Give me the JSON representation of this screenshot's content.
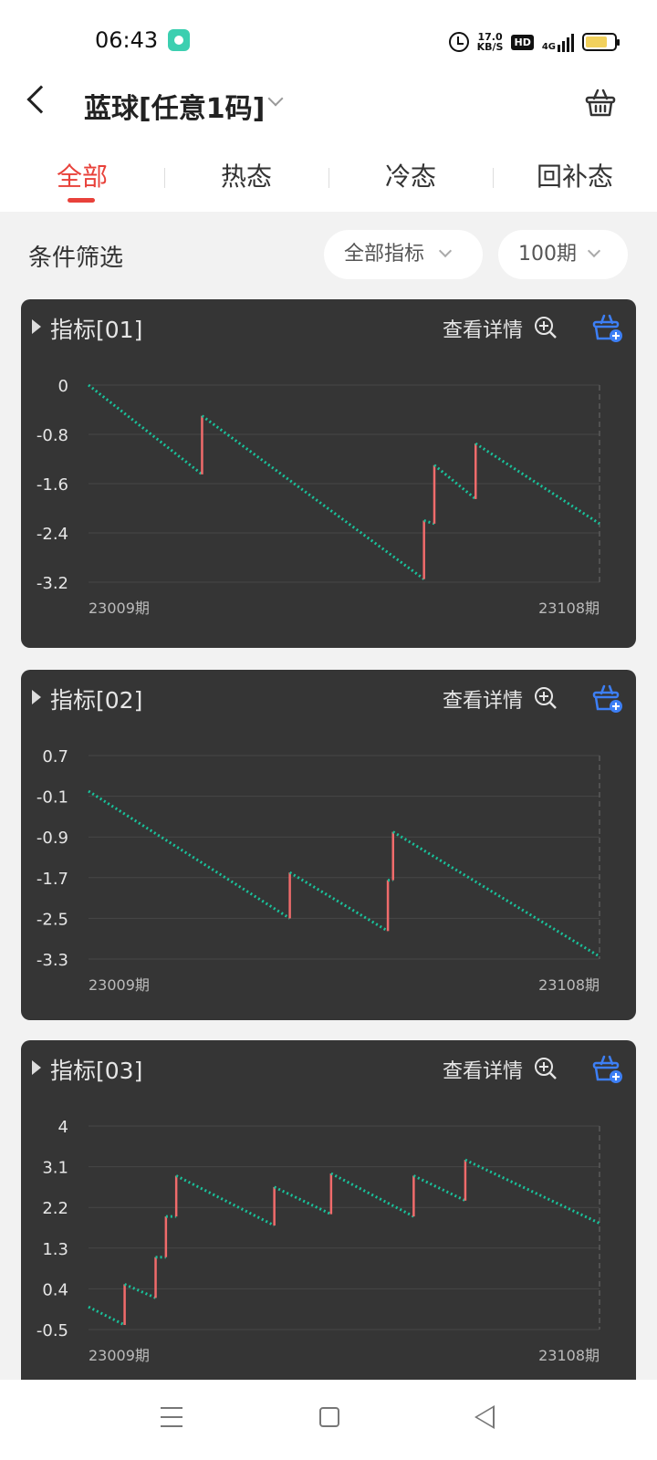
{
  "status_bar": {
    "time": "06:43",
    "net_speed_value": "17.0",
    "net_speed_unit": "KB/S",
    "hd_label": "HD",
    "network_type": "4G",
    "battery_level": 0.75,
    "battery_color": "#f2d15c"
  },
  "header": {
    "title": "蓝球[任意1码]",
    "back_icon": "chevron-left-icon",
    "cart_icon": "basket-icon"
  },
  "tabs": [
    {
      "label": "全部",
      "active": true
    },
    {
      "label": "热态",
      "active": false
    },
    {
      "label": "冷态",
      "active": false
    },
    {
      "label": "回补态",
      "active": false
    }
  ],
  "filter": {
    "label": "条件筛选",
    "indicator_select": "全部指标",
    "period_select": "100期"
  },
  "colors": {
    "accent": "#e8413a",
    "card_bg": "#353535",
    "line_green": "#19c29b",
    "jump_red": "#f06b6b",
    "basket_blue": "#3d7ff5"
  },
  "cards": [
    {
      "title": "指标[01]",
      "detail_label": "查看详情",
      "chart_data": {
        "type": "line",
        "x_start": "23009期",
        "x_end": "23108期",
        "yticks": [
          "0",
          "-0.8",
          "-1.6",
          "-2.4",
          "-3.2"
        ],
        "ylim": [
          -3.2,
          0
        ],
        "xlim": [
          0,
          99
        ],
        "vline_x": 99,
        "segments": [
          {
            "x0": 0,
            "y0": 0,
            "x1": 22,
            "y1": -1.45
          },
          {
            "x0": 22,
            "y0": -0.5,
            "x1": 65,
            "y1": -3.15
          },
          {
            "x0": 65,
            "y0": -2.2,
            "x1": 67,
            "y1": -2.25
          },
          {
            "x0": 67,
            "y0": -1.3,
            "x1": 75,
            "y1": -1.85
          },
          {
            "x0": 75,
            "y0": -0.95,
            "x1": 99,
            "y1": -2.25
          }
        ]
      }
    },
    {
      "title": "指标[02]",
      "detail_label": "查看详情",
      "chart_data": {
        "type": "line",
        "x_start": "23009期",
        "x_end": "23108期",
        "yticks": [
          "0.7",
          "-0.1",
          "-0.9",
          "-1.7",
          "-2.5",
          "-3.3"
        ],
        "ylim": [
          -3.3,
          0.7
        ],
        "xlim": [
          0,
          99
        ],
        "vline_x": 99,
        "segments": [
          {
            "x0": 0,
            "y0": 0.0,
            "x1": 39,
            "y1": -2.5
          },
          {
            "x0": 39,
            "y0": -1.6,
            "x1": 58,
            "y1": -2.75
          },
          {
            "x0": 58,
            "y0": -1.75,
            "x1": 59,
            "y1": -1.75
          },
          {
            "x0": 59,
            "y0": -0.8,
            "x1": 99,
            "y1": -3.25
          }
        ]
      }
    },
    {
      "title": "指标[03]",
      "detail_label": "查看详情",
      "chart_data": {
        "type": "line",
        "x_start": "23009期",
        "x_end": "23108期",
        "yticks": [
          "4",
          "3.1",
          "2.2",
          "1.3",
          "0.4",
          "-0.5"
        ],
        "ylim": [
          -0.5,
          4
        ],
        "xlim": [
          0,
          99
        ],
        "vline_x": 99,
        "segments": [
          {
            "x0": 0,
            "y0": 0.0,
            "x1": 7,
            "y1": -0.4
          },
          {
            "x0": 7,
            "y0": 0.5,
            "x1": 13,
            "y1": 0.2
          },
          {
            "x0": 13,
            "y0": 1.1,
            "x1": 15,
            "y1": 1.1
          },
          {
            "x0": 15,
            "y0": 2.0,
            "x1": 17,
            "y1": 2.0
          },
          {
            "x0": 17,
            "y0": 2.9,
            "x1": 36,
            "y1": 1.8
          },
          {
            "x0": 36,
            "y0": 2.65,
            "x1": 47,
            "y1": 2.05
          },
          {
            "x0": 47,
            "y0": 2.95,
            "x1": 63,
            "y1": 2.0
          },
          {
            "x0": 63,
            "y0": 2.9,
            "x1": 73,
            "y1": 2.35
          },
          {
            "x0": 73,
            "y0": 3.25,
            "x1": 99,
            "y1": 1.85
          }
        ]
      }
    }
  ]
}
